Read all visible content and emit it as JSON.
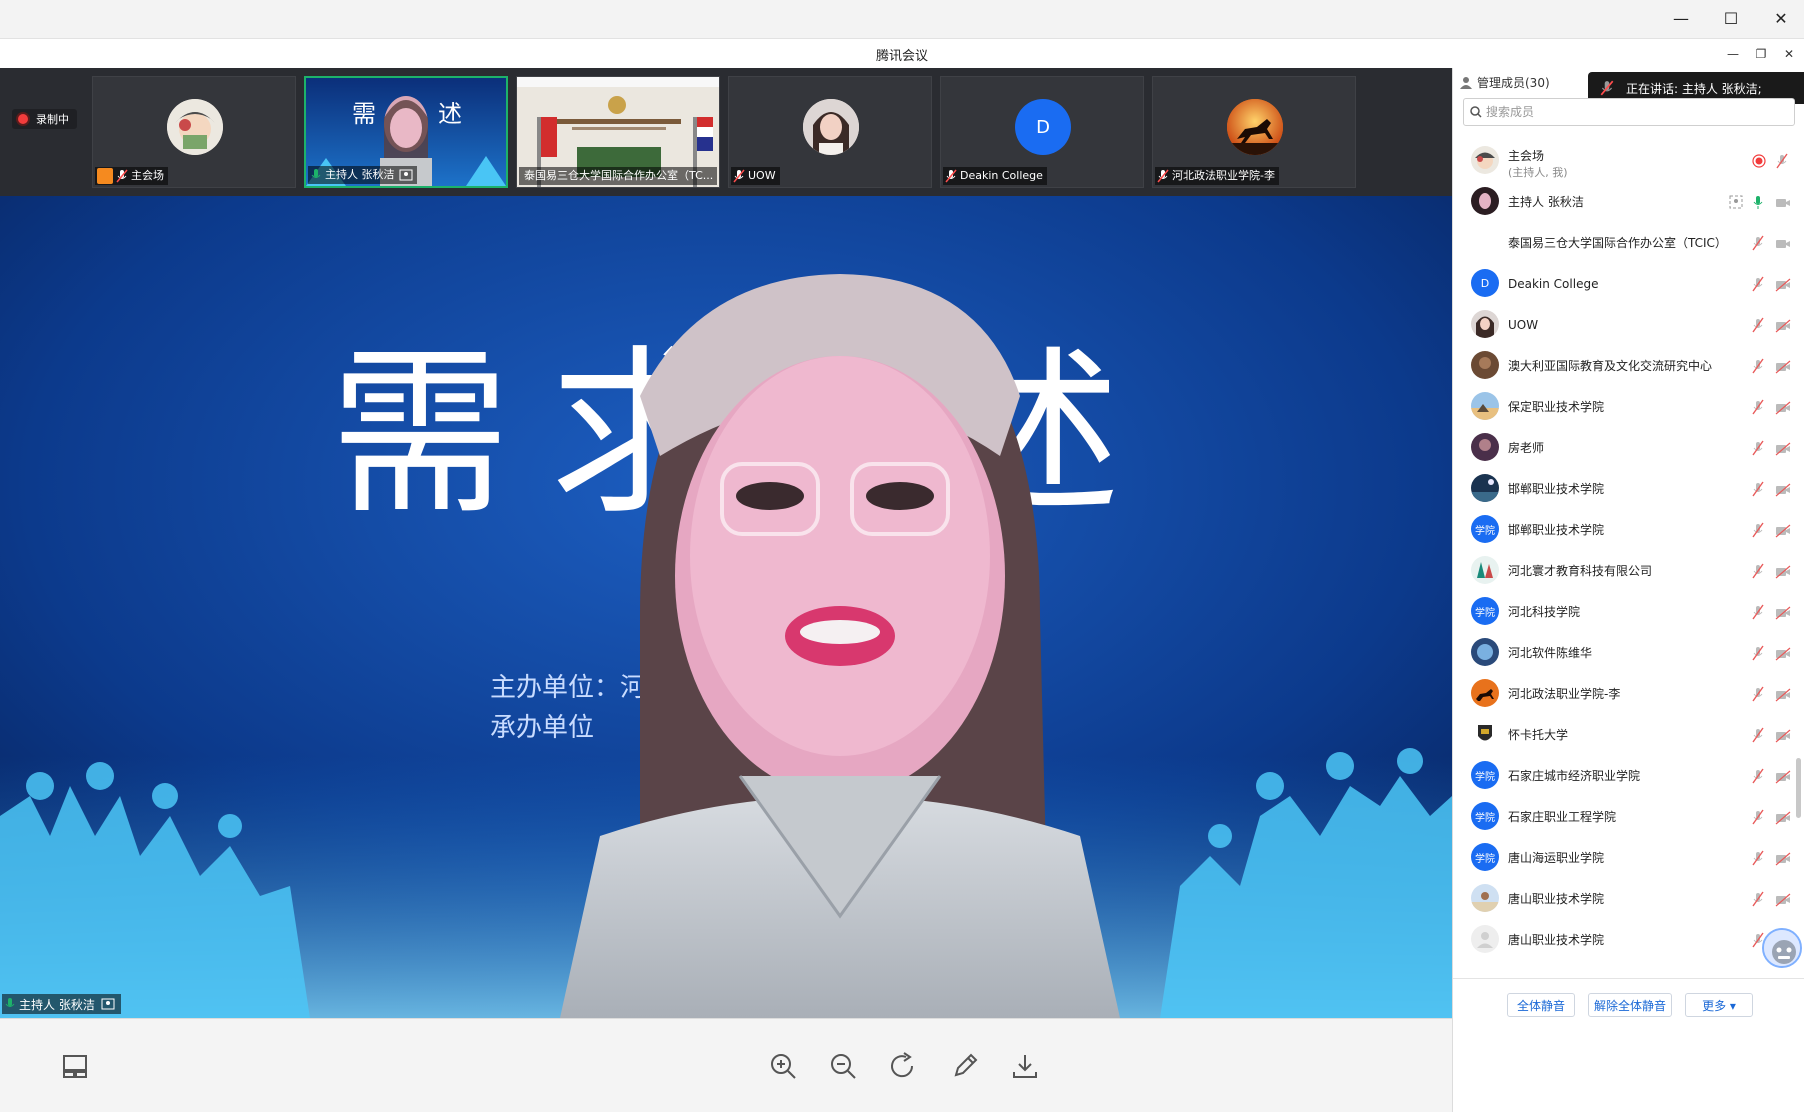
{
  "window": {
    "minimize_glyph": "—",
    "maximize_glyph": "☐",
    "close_glyph": "✕",
    "inner_title": "腾讯会议",
    "inner_minimize": "—",
    "inner_restore": "❐",
    "inner_close": "✕"
  },
  "recording": {
    "label": "录制中"
  },
  "thumbnails": [
    {
      "caption": "主会场",
      "host_badge": true
    },
    {
      "caption": "主持人 张秋洁",
      "active": true
    },
    {
      "caption": "泰国易三仓大学国际合作办公室（TC..."
    },
    {
      "caption": "UOW"
    },
    {
      "caption": "Deakin College",
      "avatar_letter": "D"
    },
    {
      "caption": "河北政法职业学院-李"
    }
  ],
  "main_video": {
    "slide_title_left": "需",
    "slide_title_mid": "求",
    "slide_title_right": "述",
    "slide_line1": "主办单位：河",
    "slide_line2": "承办单位",
    "speaker_caption": "主持人 张秋洁"
  },
  "sidebar": {
    "title": "管理成员(30)",
    "speaking": "正在讲话: 主持人 张秋洁;",
    "search_placeholder": "搜索成员",
    "members": [
      {
        "name": "主会场",
        "sub": "(主持人, 我)",
        "avatar": "photo-cartoon"
      },
      {
        "name": "主持人 张秋洁",
        "avatar": "photo-woman"
      },
      {
        "name": "泰国易三仓大学国际合作办公室（TCIC）",
        "avatar": "none"
      },
      {
        "name": "Deakin College",
        "avatar": "letter",
        "letter": "D"
      },
      {
        "name": "UOW",
        "avatar": "photo-woman2"
      },
      {
        "name": "澳大利亚国际教育及文化交流研究中心",
        "avatar": "photo-brown"
      },
      {
        "name": "保定职业技术学院",
        "avatar": "photo-sunset"
      },
      {
        "name": "房老师",
        "avatar": "photo-dark"
      },
      {
        "name": "邯郸职业技术学院",
        "avatar": "photo-night"
      },
      {
        "name": "邯郸职业技术学院",
        "avatar": "school",
        "letter": "学院"
      },
      {
        "name": "河北寰才教育科技有限公司",
        "avatar": "photo-teal"
      },
      {
        "name": "河北科技学院",
        "avatar": "school",
        "letter": "学院"
      },
      {
        "name": "河北软件陈维华",
        "avatar": "photo-blue"
      },
      {
        "name": "河北政法职业学院-李",
        "avatar": "photo-horse"
      },
      {
        "name": "怀卡托大学",
        "avatar": "photo-crest"
      },
      {
        "name": "石家庄城市经济职业学院",
        "avatar": "school",
        "letter": "学院"
      },
      {
        "name": "石家庄职业工程学院",
        "avatar": "school",
        "letter": "学院"
      },
      {
        "name": "唐山海运职业学院",
        "avatar": "school",
        "letter": "学院"
      },
      {
        "name": "唐山职业技术学院",
        "avatar": "photo-sky"
      },
      {
        "name": "唐山职业技术学院",
        "avatar": "default"
      }
    ],
    "mute_all": "全体静音",
    "unmute_all": "解除全体静音",
    "more": "更多 ▾"
  },
  "colors": {
    "accent": "#1a68d6",
    "active_green": "#1db26a",
    "record_red": "#f23c3c"
  }
}
